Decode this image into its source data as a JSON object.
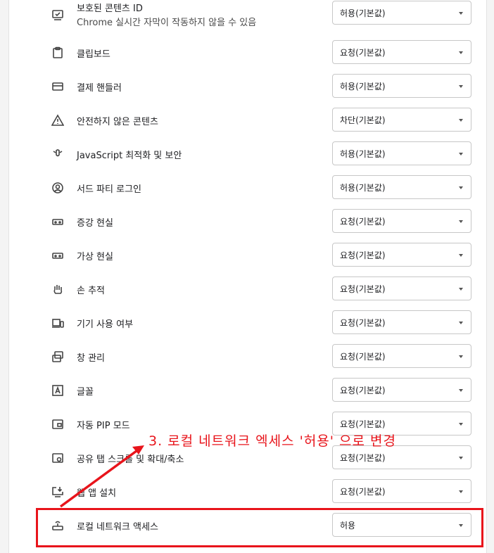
{
  "colors": {
    "accent_red": "#e8141b",
    "text": "#202124",
    "border": "#c7c7c7"
  },
  "annotation": {
    "text": "3. 로컬 네트워크 엑세스 '허용' 으로 변경"
  },
  "rows": [
    {
      "label": "보호된 콘텐츠 ID",
      "sublabel": "Chrome 실시간 자막이 작동하지 않을 수 있음",
      "value": "허용(기본값)",
      "icon": "protected-content-icon"
    },
    {
      "label": "클립보드",
      "value": "요청(기본값)",
      "icon": "clipboard-icon"
    },
    {
      "label": "결제 핸들러",
      "value": "허용(기본값)",
      "icon": "credit-card-icon"
    },
    {
      "label": "안전하지 않은 콘텐츠",
      "value": "차단(기본값)",
      "icon": "warning-icon"
    },
    {
      "label": "JavaScript 최적화 및 보안",
      "value": "허용(기본값)",
      "icon": "javascript-icon"
    },
    {
      "label": "서드 파티 로그인",
      "value": "허용(기본값)",
      "icon": "account-circle-icon"
    },
    {
      "label": "증강 현실",
      "value": "요청(기본값)",
      "icon": "ar-goggles-icon"
    },
    {
      "label": "가상 현실",
      "value": "요청(기본값)",
      "icon": "vr-goggles-icon"
    },
    {
      "label": "손 추적",
      "value": "요청(기본값)",
      "icon": "hand-icon"
    },
    {
      "label": "기기 사용 여부",
      "value": "요청(기본값)",
      "icon": "devices-icon"
    },
    {
      "label": "창 관리",
      "value": "요청(기본값)",
      "icon": "window-management-icon"
    },
    {
      "label": "글꼴",
      "value": "요청(기본값)",
      "icon": "font-icon"
    },
    {
      "label": "자동 PIP 모드",
      "value": "요청(기본값)",
      "icon": "picture-in-picture-icon"
    },
    {
      "label": "공유 탭 스크롤 및 확대/축소",
      "value": "요청(기본값)",
      "icon": "shared-tab-icon"
    },
    {
      "label": "웹 앱 설치",
      "value": "요청(기본값)",
      "icon": "install-app-icon"
    },
    {
      "label": "로컬 네트워크 액세스",
      "value": "허용",
      "icon": "router-icon"
    }
  ]
}
